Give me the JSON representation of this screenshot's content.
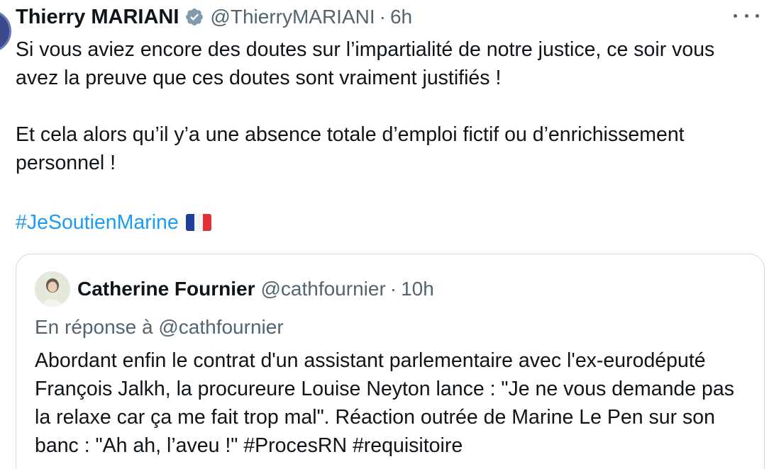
{
  "tweet": {
    "author_name": "Thierry MARIANI",
    "author_handle": "@ThierryMARIANI",
    "separator": "·",
    "time": "6h",
    "paragraph_1": "Si vous aviez encore des doutes sur l’impartialité de notre justice, ce soir vous avez la preuve que ces doutes sont vraiment justifiés !",
    "paragraph_2": "Et cela alors qu’il y’a une absence totale d’emploi fictif ou d’enrichissement personnel !",
    "hashtag": "#JeSoutienMarine",
    "emoji_icon": "french-flag-icon"
  },
  "quote": {
    "author_name": "Catherine Fournier",
    "author_handle": "@cathfournier",
    "separator": "·",
    "time": "10h",
    "reply_prefix": "En réponse à",
    "reply_handle": "@cathfournier",
    "text": "Abordant enfin le contrat d'un assistant parlementaire avec l'ex-eurodéputé François Jalkh, la procureure Louise Neyton lance : \"Je ne vous demande pas la relaxe car ça me fait trop mal\". Réaction outrée de Marine Le Pen sur son banc : \"Ah ah, l’aveu !\" #ProcesRN #requisitoire"
  },
  "colors": {
    "text": "#0f1419",
    "secondary": "#536471",
    "link": "#1d9bf0",
    "border": "#cfd9de"
  }
}
